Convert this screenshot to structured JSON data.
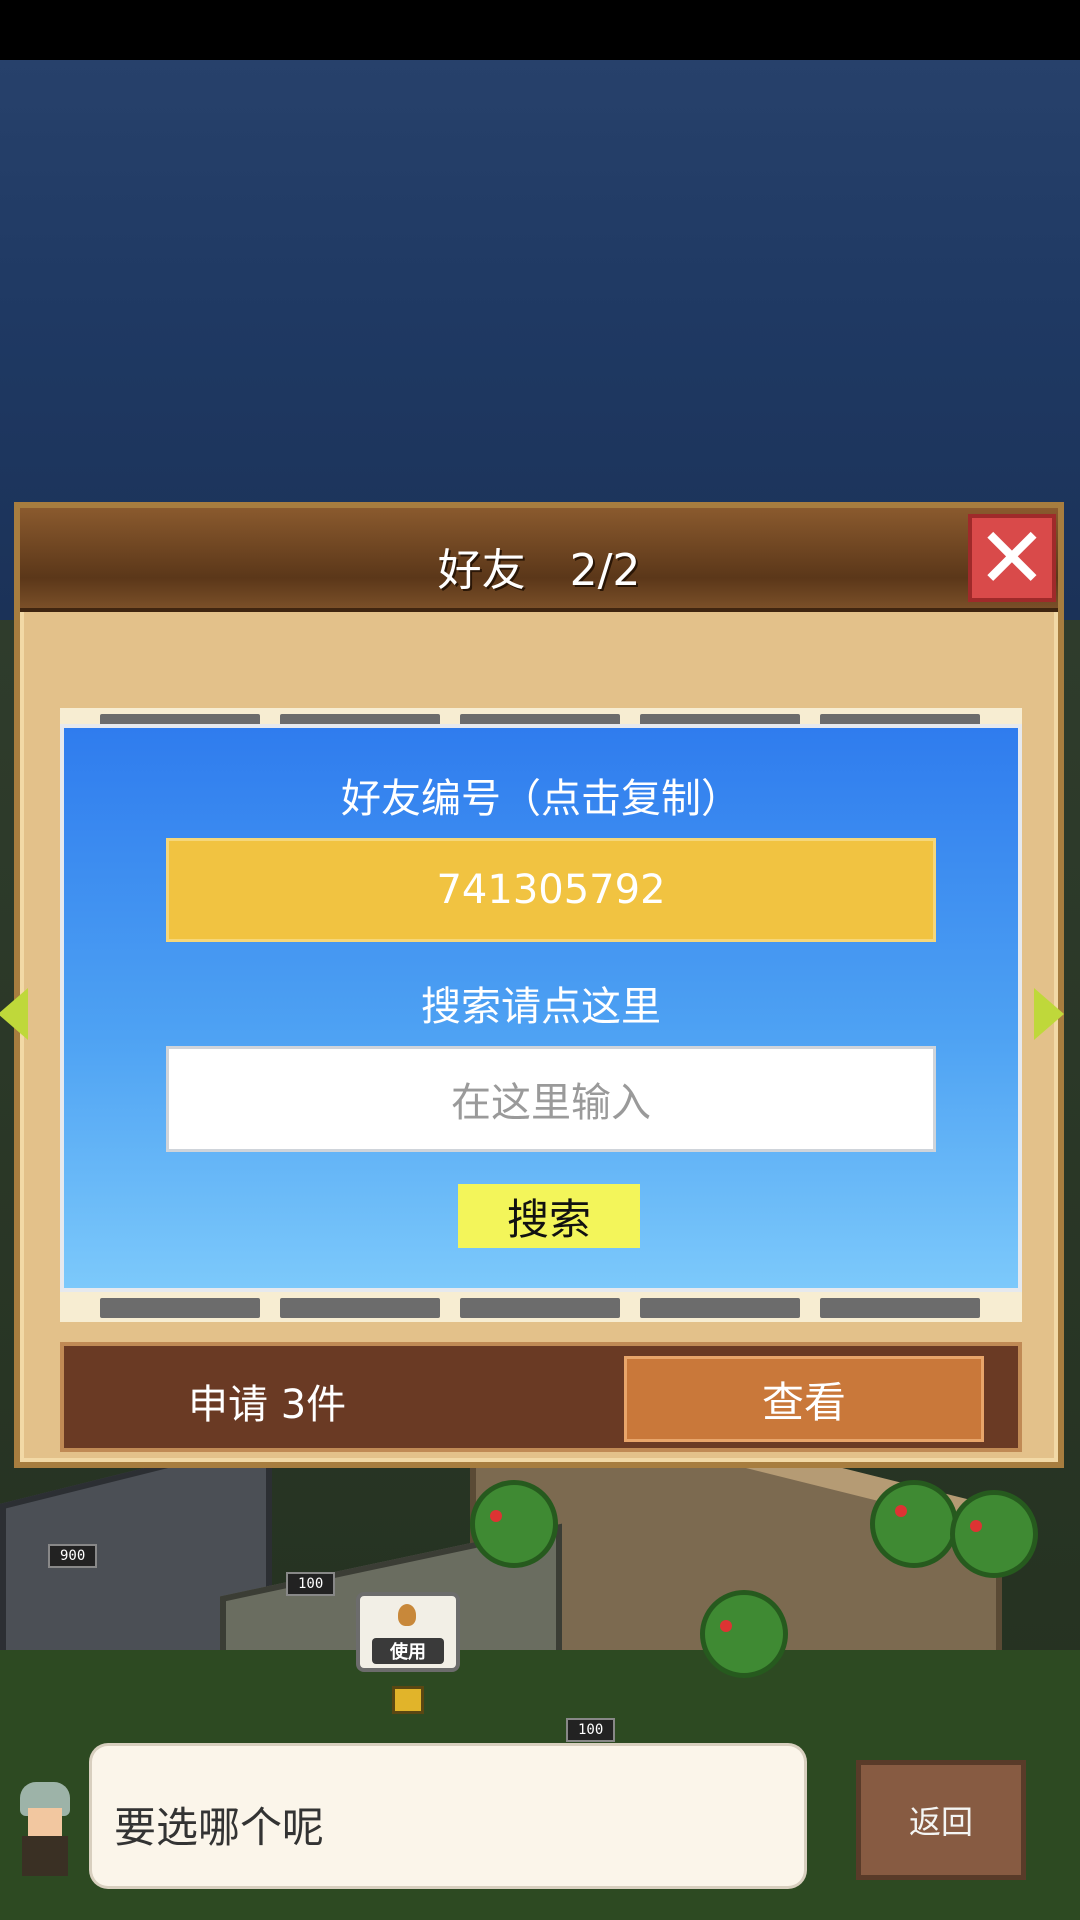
{
  "dialog": {
    "title": "好友　2/2",
    "close_icon": "✕"
  },
  "friend_id": {
    "label": "好友编号（点击复制）",
    "value": "741305792"
  },
  "search": {
    "label": "搜索请点这里",
    "placeholder": "在这里输入",
    "button": "搜索"
  },
  "requests": {
    "text": "申请 3件",
    "view_button": "查看"
  },
  "map_signs": {
    "sign1": "900",
    "sign2": "100",
    "sign3": "100",
    "use_badge": "使用"
  },
  "message": {
    "text": "要选哪个呢"
  },
  "back_button": "返回"
}
